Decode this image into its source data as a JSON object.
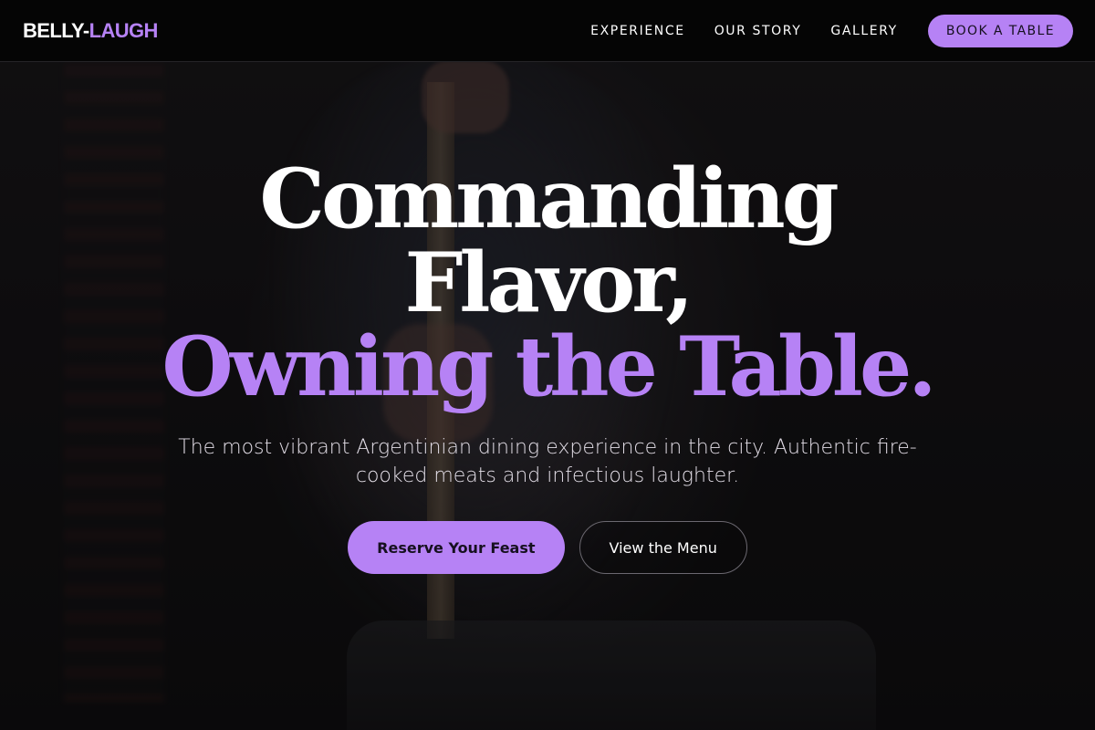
{
  "brand": {
    "name_part1": "BELLY-",
    "name_part2": "LAUGH",
    "accent_color": "#b682f5"
  },
  "nav": {
    "links": [
      {
        "label": "EXPERIENCE"
      },
      {
        "label": "OUR STORY"
      },
      {
        "label": "GALLERY"
      }
    ],
    "cta_label": "BOOK A TABLE"
  },
  "hero": {
    "headline_line1": "Commanding",
    "headline_line2": "Flavor,",
    "headline_line3": "Owning the Table.",
    "subtitle": "The most vibrant Argentinian dining experience in the city. Authentic fire-cooked meats and infectious laughter.",
    "primary_cta": "Reserve Your Feast",
    "secondary_cta": "View the Menu"
  },
  "colors": {
    "nav_background": "#050505",
    "page_background": "#141215",
    "text_primary": "#ffffff",
    "accent": "#b682f5"
  }
}
